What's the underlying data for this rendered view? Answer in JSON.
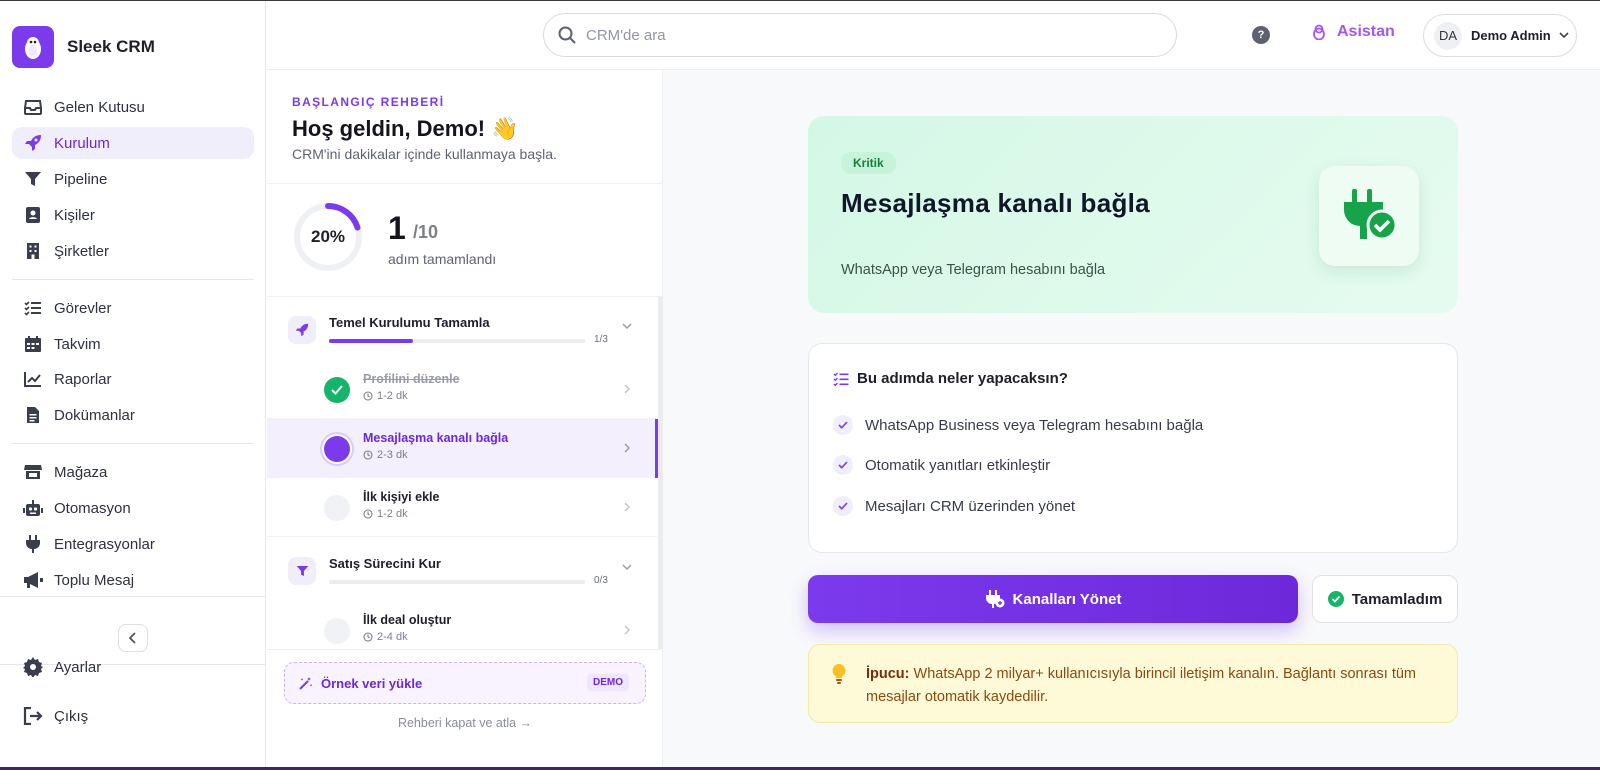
{
  "app": {
    "name": "Sleek CRM"
  },
  "sidebar": {
    "items": [
      {
        "label": "Gelen Kutusu",
        "icon": "inbox-icon"
      },
      {
        "label": "Kurulum",
        "icon": "rocket-icon",
        "active": true
      },
      {
        "label": "Pipeline",
        "icon": "filter-icon"
      },
      {
        "label": "Kişiler",
        "icon": "contact-icon"
      },
      {
        "label": "Şirketler",
        "icon": "building-icon"
      },
      {
        "label": "Görevler",
        "icon": "tasks-icon"
      },
      {
        "label": "Takvim",
        "icon": "calendar-icon"
      },
      {
        "label": "Raporlar",
        "icon": "chart-icon"
      },
      {
        "label": "Dokümanlar",
        "icon": "document-icon"
      },
      {
        "label": "Mağaza",
        "icon": "store-icon"
      },
      {
        "label": "Otomasyon",
        "icon": "robot-icon"
      },
      {
        "label": "Entegrasyonlar",
        "icon": "plug-icon"
      },
      {
        "label": "Toplu Mesaj",
        "icon": "megaphone-icon"
      }
    ],
    "settings": "Ayarlar",
    "logout": "Çıkış"
  },
  "header": {
    "search_placeholder": "CRM'de ara",
    "help": "?",
    "assistant": "Asistan",
    "user_initials": "DA",
    "user_name": "Demo Admin"
  },
  "guide": {
    "label": "BAŞLANGIÇ REHBERİ",
    "title": "Hoş geldin, Demo! 👋",
    "subtitle": "CRM'ini dakikalar içinde kullanmaya başla.",
    "progress_percent": "20%",
    "progress_value": 0.2,
    "completed": "1",
    "total": "/10",
    "completed_label": "adım tamamlandı",
    "groups": [
      {
        "title": "Temel Kurulumu Tamamla",
        "count": "1/3",
        "progress": 0.33,
        "steps": [
          {
            "title": "Profilini düzenle",
            "time": "1-2 dk",
            "state": "done"
          },
          {
            "title": "Mesajlaşma kanalı bağla",
            "time": "2-3 dk",
            "state": "current"
          },
          {
            "title": "İlk kişiyi ekle",
            "time": "1-2 dk",
            "state": "todo"
          }
        ]
      },
      {
        "title": "Satış Sürecini Kur",
        "count": "0/3",
        "progress": 0,
        "steps": [
          {
            "title": "İlk deal oluştur",
            "time": "2-4 dk",
            "state": "todo"
          }
        ]
      }
    ],
    "sample_data": "Örnek veri yükle",
    "demo_badge": "DEMO",
    "close": "Rehberi kapat ve atla →"
  },
  "main": {
    "tag": "Kritik",
    "title": "Mesajlaşma kanalı bağla",
    "subtitle": "WhatsApp veya Telegram hesabını bağla",
    "todo_title": "Bu adımda neler yapacaksın?",
    "todo_items": [
      "WhatsApp Business veya Telegram hesabını bağla",
      "Otomatik yanıtları etkinleştir",
      "Mesajları CRM üzerinden yönet"
    ],
    "primary_button": "Kanalları Yönet",
    "done_button": "Tamamladım",
    "tip_label": "İpucu:",
    "tip_text": "WhatsApp 2 milyar+ kullanıcısıyla birincil iletişim kanalın. Bağlantı sonrası tüm mesajlar otomatik kaydedilir."
  },
  "colors": {
    "accent": "#7c3aed",
    "success": "#16b36b",
    "hero_bg": "#d4f8e6",
    "tip_bg": "#fef9d7"
  }
}
